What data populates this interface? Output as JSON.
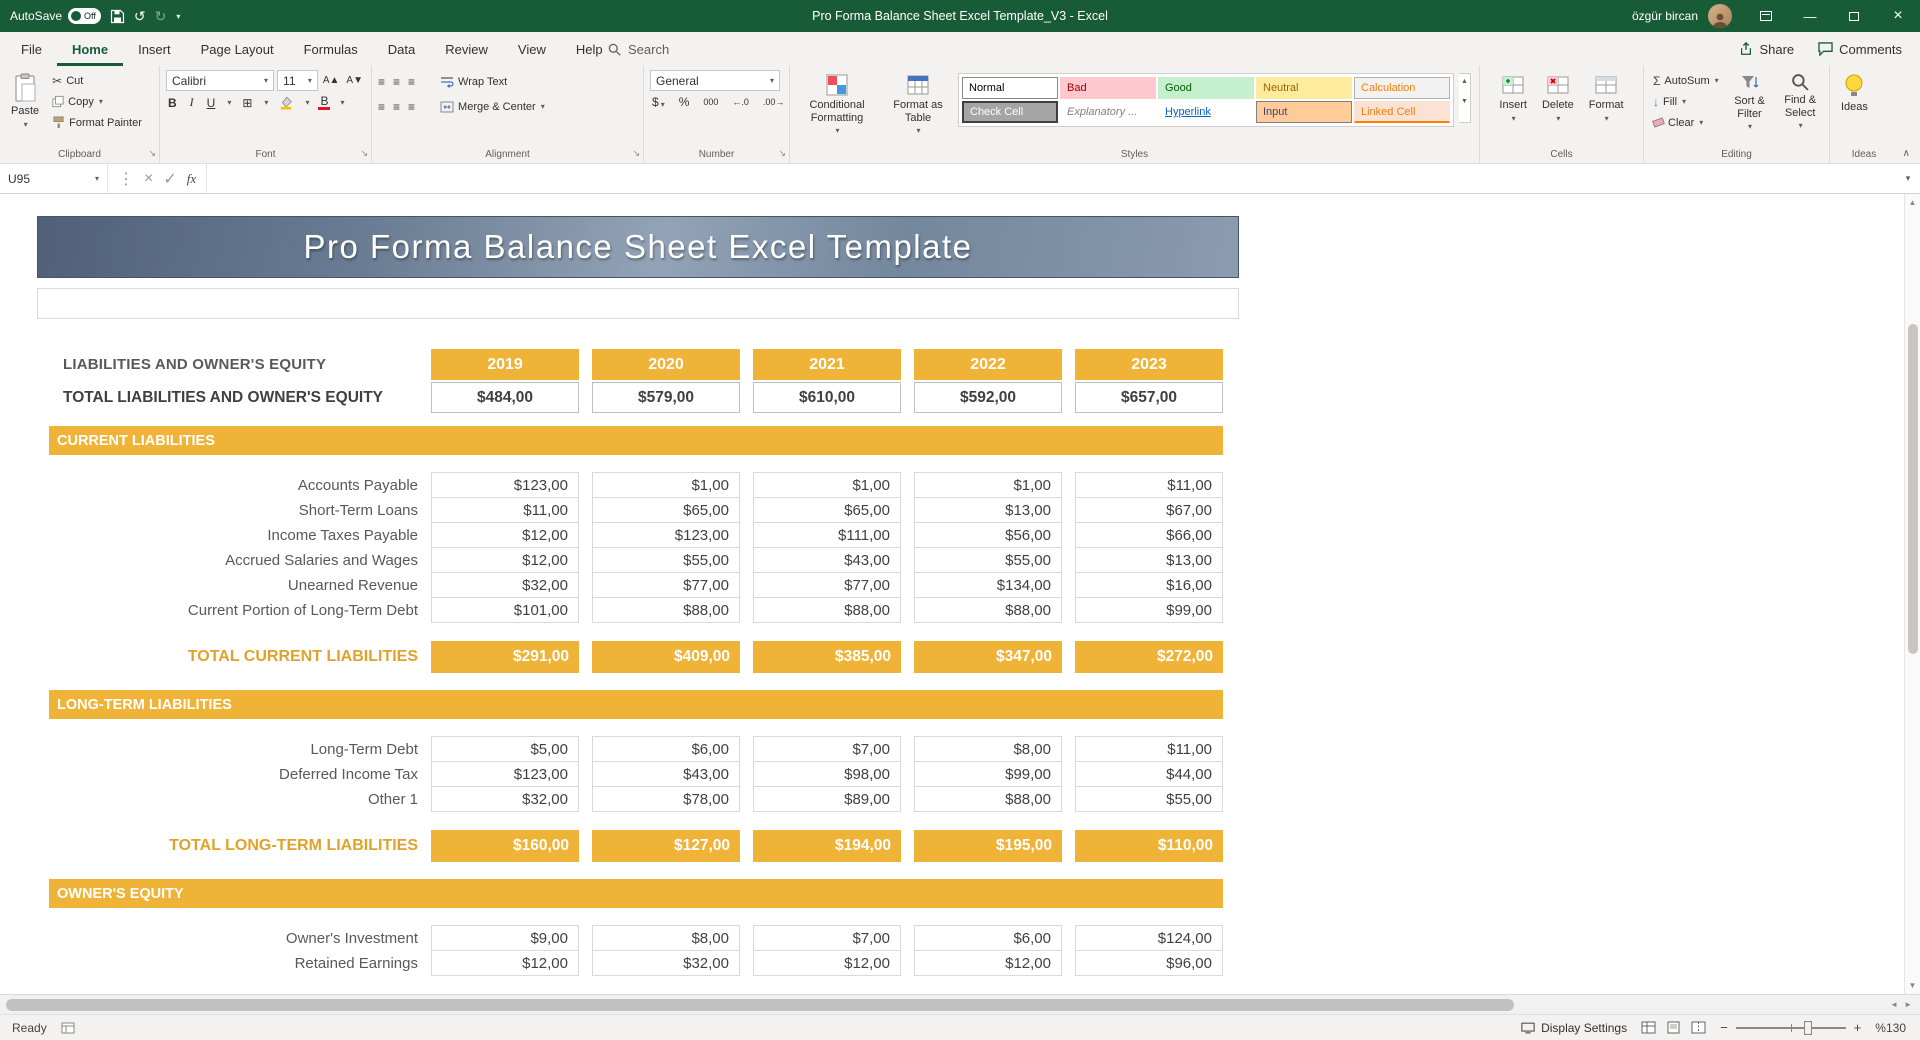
{
  "colors": {
    "excel_green": "#185C37",
    "orange": "#EFB338",
    "banner_dark": "#4F6078",
    "banner_light": "#93A3B7"
  },
  "titlebar": {
    "autosave_label": "AutoSave",
    "autosave_state": "Off",
    "title": "Pro Forma Balance Sheet Excel Template_V3 - Excel",
    "user_name": "özgür bircan"
  },
  "ribbon_tabs": [
    {
      "label": "File"
    },
    {
      "label": "Home",
      "active": true
    },
    {
      "label": "Insert"
    },
    {
      "label": "Page Layout"
    },
    {
      "label": "Formulas"
    },
    {
      "label": "Data"
    },
    {
      "label": "Review"
    },
    {
      "label": "View"
    },
    {
      "label": "Help"
    }
  ],
  "search_label": "Search",
  "share_label": "Share",
  "comments_label": "Comments",
  "ribbon": {
    "clipboard": {
      "group": "Clipboard",
      "paste": "Paste",
      "cut": "Cut",
      "copy": "Copy",
      "format_painter": "Format Painter"
    },
    "font": {
      "group": "Font",
      "family": "Calibri",
      "size": "11"
    },
    "alignment": {
      "group": "Alignment",
      "wrap_text": "Wrap Text",
      "merge_center": "Merge & Center"
    },
    "number": {
      "group": "Number",
      "format": "General"
    },
    "styles": {
      "group": "Styles",
      "conditional": "Conditional Formatting",
      "format_table": "Format as Table",
      "items": [
        {
          "label": "Normal",
          "kind": "normal"
        },
        {
          "label": "Bad",
          "kind": "bad"
        },
        {
          "label": "Good",
          "kind": "good"
        },
        {
          "label": "Neutral",
          "kind": "neutral"
        },
        {
          "label": "Calculation",
          "kind": "calculation"
        },
        {
          "label": "Check Cell",
          "kind": "check"
        },
        {
          "label": "Explanatory ...",
          "kind": "explanatory"
        },
        {
          "label": "Hyperlink",
          "kind": "hyperlink"
        },
        {
          "label": "Input",
          "kind": "input"
        },
        {
          "label": "Linked Cell",
          "kind": "linked"
        }
      ]
    },
    "cells": {
      "group": "Cells",
      "insert": "Insert",
      "delete": "Delete",
      "format": "Format"
    },
    "editing": {
      "group": "Editing",
      "autosum": "AutoSum",
      "fill": "Fill",
      "clear": "Clear",
      "sort_filter": "Sort & Filter",
      "find_select": "Find & Select"
    },
    "ideas": {
      "group": "Ideas",
      "label": "Ideas"
    }
  },
  "formula_bar": {
    "name_box": "U95",
    "value": ""
  },
  "sheet": {
    "banner_title": "Pro Forma Balance Sheet Excel Template",
    "header_label": "LIABILITIES AND OWNER'S EQUITY",
    "years": [
      "2019",
      "2020",
      "2021",
      "2022",
      "2023"
    ],
    "grand_total": {
      "label": "TOTAL LIABILITIES AND OWNER'S EQUITY",
      "values": [
        "$484,00",
        "$579,00",
        "$610,00",
        "$592,00",
        "$657,00"
      ]
    },
    "sections": [
      {
        "title": "CURRENT LIABILITIES",
        "rows": [
          {
            "label": "Accounts Payable",
            "values": [
              "$123,00",
              "$1,00",
              "$1,00",
              "$1,00",
              "$11,00"
            ]
          },
          {
            "label": "Short-Term Loans",
            "values": [
              "$11,00",
              "$65,00",
              "$65,00",
              "$13,00",
              "$67,00"
            ]
          },
          {
            "label": "Income Taxes Payable",
            "values": [
              "$12,00",
              "$123,00",
              "$111,00",
              "$56,00",
              "$66,00"
            ]
          },
          {
            "label": "Accrued Salaries and Wages",
            "values": [
              "$12,00",
              "$55,00",
              "$43,00",
              "$55,00",
              "$13,00"
            ]
          },
          {
            "label": "Unearned Revenue",
            "values": [
              "$32,00",
              "$77,00",
              "$77,00",
              "$134,00",
              "$16,00"
            ]
          },
          {
            "label": "Current Portion of Long-Term Debt",
            "values": [
              "$101,00",
              "$88,00",
              "$88,00",
              "$88,00",
              "$99,00"
            ]
          }
        ],
        "total": {
          "label": "TOTAL CURRENT LIABILITIES",
          "values": [
            "$291,00",
            "$409,00",
            "$385,00",
            "$347,00",
            "$272,00"
          ]
        }
      },
      {
        "title": "LONG-TERM LIABILITIES",
        "rows": [
          {
            "label": "Long-Term Debt",
            "values": [
              "$5,00",
              "$6,00",
              "$7,00",
              "$8,00",
              "$11,00"
            ]
          },
          {
            "label": "Deferred Income Tax",
            "values": [
              "$123,00",
              "$43,00",
              "$98,00",
              "$99,00",
              "$44,00"
            ]
          },
          {
            "label": "Other 1",
            "values": [
              "$32,00",
              "$78,00",
              "$89,00",
              "$88,00",
              "$55,00"
            ]
          }
        ],
        "total": {
          "label": "TOTAL LONG-TERM LIABILITIES",
          "values": [
            "$160,00",
            "$127,00",
            "$194,00",
            "$195,00",
            "$110,00"
          ]
        }
      },
      {
        "title": "OWNER'S EQUITY",
        "rows": [
          {
            "label": "Owner's Investment",
            "values": [
              "$9,00",
              "$8,00",
              "$7,00",
              "$6,00",
              "$124,00"
            ]
          },
          {
            "label": "Retained Earnings",
            "values": [
              "$12,00",
              "$32,00",
              "$12,00",
              "$12,00",
              "$96,00"
            ]
          }
        ],
        "total": null
      }
    ]
  },
  "status_bar": {
    "ready": "Ready",
    "display_settings": "Display Settings",
    "zoom": "%130"
  },
  "icons": {
    "dropdown": "▾",
    "undo": "↺",
    "redo": "↻",
    "cut": "✂",
    "bold": "B",
    "italic": "I",
    "underline": "U",
    "grow_font": "A▲",
    "shrink_font": "A▼",
    "borders": "⊞",
    "align": "≡",
    "dollar": "$",
    "percent": "%",
    "comma": "000",
    "dec_inc": "←.0",
    "dec_dec": ".00→",
    "sigma": "Σ",
    "fill_down": "↓",
    "close": "×",
    "check": "✓",
    "fx": "fx",
    "handle": "⋮",
    "collapse": "∧",
    "minimize": "—",
    "launcher": "↘",
    "scroll_up": "▲",
    "scroll_down": "▼",
    "scroll_left": "◄",
    "scroll_right": "►",
    "zoom_out": "−",
    "zoom_in": "+"
  }
}
